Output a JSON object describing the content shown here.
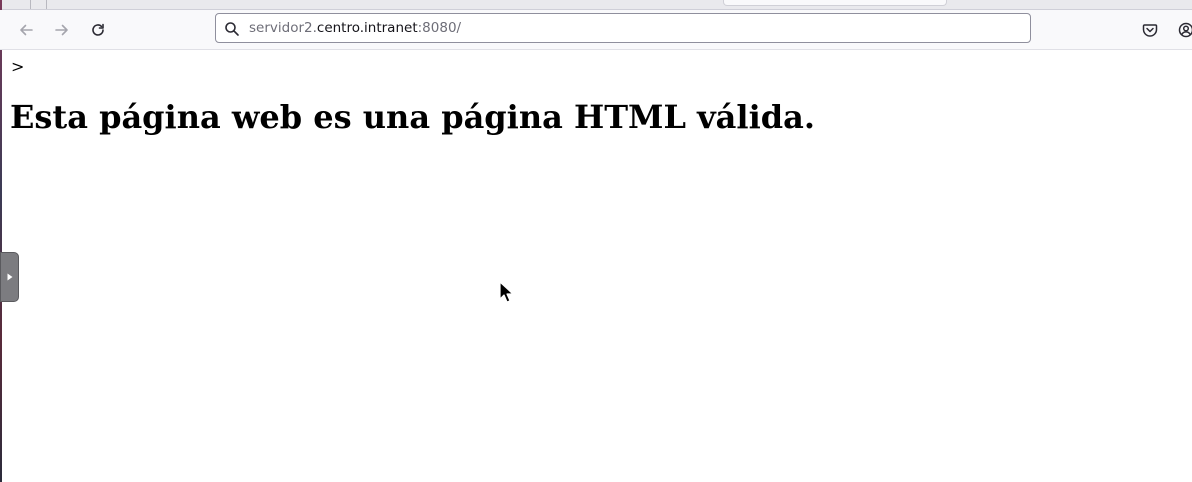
{
  "browser": {
    "url": {
      "subdomain": "servidor2.",
      "domain": "centro.intranet",
      "port_path": ":8080/"
    },
    "toolbar": {
      "back_icon": "arrow-left-icon",
      "forward_icon": "arrow-right-icon",
      "reload_icon": "reload-icon",
      "search_icon": "search-icon",
      "pocket_icon": "pocket-icon",
      "account_icon": "account-icon"
    }
  },
  "page": {
    "stray_text": ">",
    "heading": "Esta página web es una página HTML válida."
  },
  "side_panel": {
    "handle_icon": "triangle-right-icon"
  }
}
